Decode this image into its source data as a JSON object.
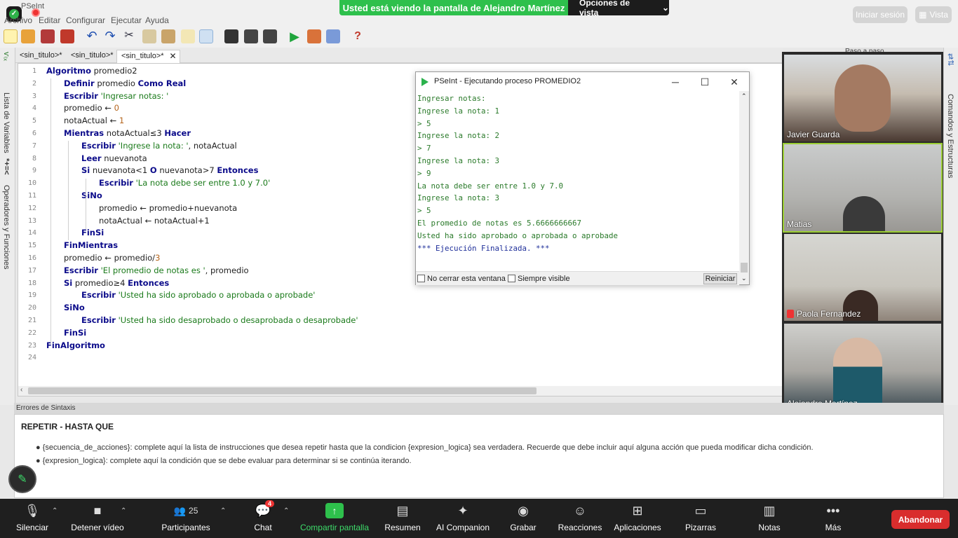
{
  "app": {
    "title": "PSeInt"
  },
  "menu": [
    "Archivo",
    "Editar",
    "Configurar",
    "Ejecutar",
    "Ayuda"
  ],
  "share_banner": {
    "text": "Usted está viendo la pantalla de Alejandro Martínez",
    "options": "Opciones de vista"
  },
  "top_right": {
    "login": "Iniciar sesión",
    "view": "Vista"
  },
  "tabs": [
    {
      "label": "<sin_titulo>*"
    },
    {
      "label": "<sin_titulo>*"
    },
    {
      "label": "<sin_titulo>*"
    }
  ],
  "left_sidebar": {
    "variables": "Lista de Variables",
    "operators": "Operadores y Funciones"
  },
  "right_sidebar": {
    "commands": "Comandos y Estructuras",
    "panel_title": "Paso a paso"
  },
  "editor": {
    "line_numbers": [
      "1",
      "2",
      "3",
      "4",
      "5",
      "6",
      "7",
      "8",
      "9",
      "10",
      "11",
      "12",
      "13",
      "14",
      "15",
      "16",
      "17",
      "18",
      "19",
      "20",
      "21",
      "22",
      "23",
      "24"
    ],
    "lines": [
      [
        "Algoritmo",
        " promedio2"
      ],
      [
        "Definir",
        " promedio ",
        "Como Real"
      ],
      [
        "Escribir",
        " ",
        "'Ingresar notas: '"
      ],
      [
        "promedio ← ",
        "0"
      ],
      [
        "notaActual ← ",
        "1"
      ],
      [
        "Mientras",
        " notaActual≤3 ",
        "Hacer"
      ],
      [
        "Escribir",
        " ",
        "'Ingrese la nota: '",
        ", notaActual"
      ],
      [
        "Leer",
        " nuevanota"
      ],
      [
        "Si",
        " nuevanota<1 ",
        "O",
        " nuevanota>7 ",
        "Entonces"
      ],
      [
        "Escribir",
        " ",
        "'La nota debe ser entre 1.0 y 7.0'"
      ],
      [
        "SiNo"
      ],
      [
        "promedio ← promedio+nuevanota"
      ],
      [
        "notaActual ← notaActual+1"
      ],
      [
        "FinSi"
      ],
      [
        "FinMientras"
      ],
      [
        "promedio ← promedio/",
        "3"
      ],
      [
        "Escribir",
        " ",
        "'El promedio de notas es '",
        ", promedio"
      ],
      [
        "Si",
        " promedio≥4 ",
        "Entonces"
      ],
      [
        "Escribir",
        " ",
        "'Usted ha sido aprobado o aprobada o aprobade'"
      ],
      [
        "SiNo"
      ],
      [
        "Escribir",
        " ",
        "'Usted ha sido desaprobado o desaprobada o desaprobade'"
      ],
      [
        "FinSi"
      ],
      [
        "FinAlgoritmo"
      ],
      [
        ""
      ]
    ]
  },
  "console": {
    "title": "PSeInt - Ejecutando proceso PROMEDIO2",
    "lines": [
      "Ingresar notas:",
      "Ingrese la nota: 1",
      "> 5",
      "Ingrese la nota: 2",
      "> 7",
      "Ingrese la nota: 3",
      "> 9",
      "La nota debe ser entre 1.0 y 7.0",
      "Ingrese la nota: 3",
      "> 5",
      "El promedio de notas es 5.6666666667",
      "Usted ha sido aprobado o aprobada o aprobade",
      "*** Ejecución Finalizada. ***"
    ],
    "no_close": "No cerrar esta ventana",
    "always_visible": "Siempre visible",
    "restart": "Reiniciar"
  },
  "participants_video": [
    {
      "name": "Javier Guarda"
    },
    {
      "name": "Matias"
    },
    {
      "name": "Paola Fernandez"
    },
    {
      "name": "Alejandro Martínez"
    }
  ],
  "errors_panel": {
    "header": "Errores de Sintaxis",
    "help_title": "REPETIR - HASTA QUE",
    "bullets": [
      "{secuencia_de_acciones}: complete aquí la lista de instrucciones que desea repetir hasta que la condicion {expresion_logica} sea verdadera. Recuerde que debe incluir aquí alguna acción que pueda modificar dicha condición.",
      "{expresion_logica}: complete aquí la condición que se debe evaluar para determinar si se continúa iterando."
    ]
  },
  "zoom_toolbar": {
    "mute": "Silenciar",
    "video": "Detener vídeo",
    "participants": "Participantes",
    "participants_count": "25",
    "chat": "Chat",
    "chat_badge": "4",
    "share": "Compartir pantalla",
    "summary": "Resumen",
    "ai": "AI Companion",
    "record": "Grabar",
    "reactions": "Reacciones",
    "apps": "Aplicaciones",
    "whiteboards": "Pizarras",
    "notes": "Notas",
    "more": "Más",
    "leave": "Abandonar"
  },
  "colors": {
    "accent_green": "#2ec04c",
    "leave_red": "#d92d2d",
    "keyword": "#0b0b8a",
    "string": "#1a7a1a"
  }
}
